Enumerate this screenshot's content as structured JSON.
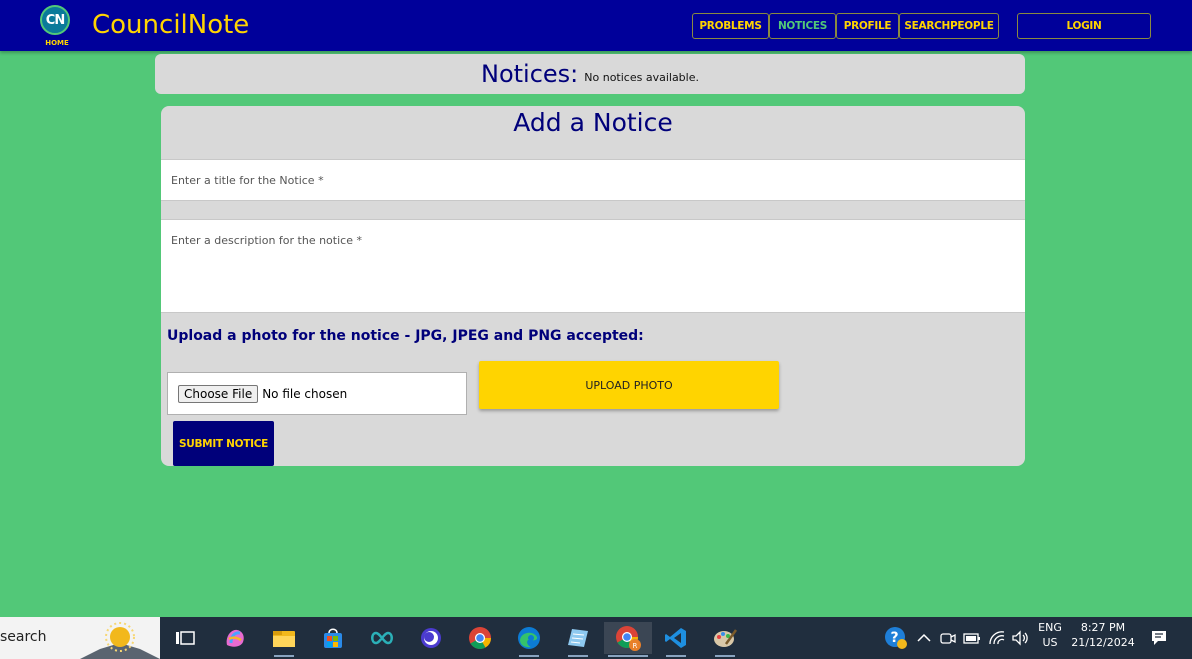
{
  "navbar": {
    "logo_letters": "CN",
    "logo_home": "HOME",
    "brand": "CouncilNote",
    "links": [
      "PROBLEMS",
      "NOTICES",
      "PROFILE",
      "SEARCHPEOPLE"
    ],
    "active_link": "NOTICES",
    "login": "LOGIN"
  },
  "notices": {
    "title": "Notices:",
    "empty_text": "No notices available."
  },
  "form": {
    "title": "Add a Notice",
    "title_placeholder": "Enter a title for the Notice *",
    "description_placeholder": "Enter a description for the notice *",
    "upload_label": "Upload a photo for the notice - JPG, JPEG and PNG accepted:",
    "choose_file": "Choose File",
    "no_file": "No file chosen",
    "upload_button": "UPLOAD PHOTO",
    "submit_button": "SUBMIT NOTICE"
  },
  "taskbar": {
    "search_text": "search",
    "apps": [
      "task-view",
      "copilot",
      "file-explorer",
      "microsoft-store",
      "arduino",
      "app-circle",
      "chrome",
      "edge",
      "notepad",
      "chrome-profile",
      "vscode",
      "paint"
    ],
    "language": "ENG",
    "region": "US",
    "time": "8:27 PM",
    "date": "21/12/2024"
  },
  "colors": {
    "background": "#52c878",
    "navbar": "#00009a",
    "accent": "#ffd400",
    "card": "#d9d9d9",
    "heading": "#00007a"
  }
}
